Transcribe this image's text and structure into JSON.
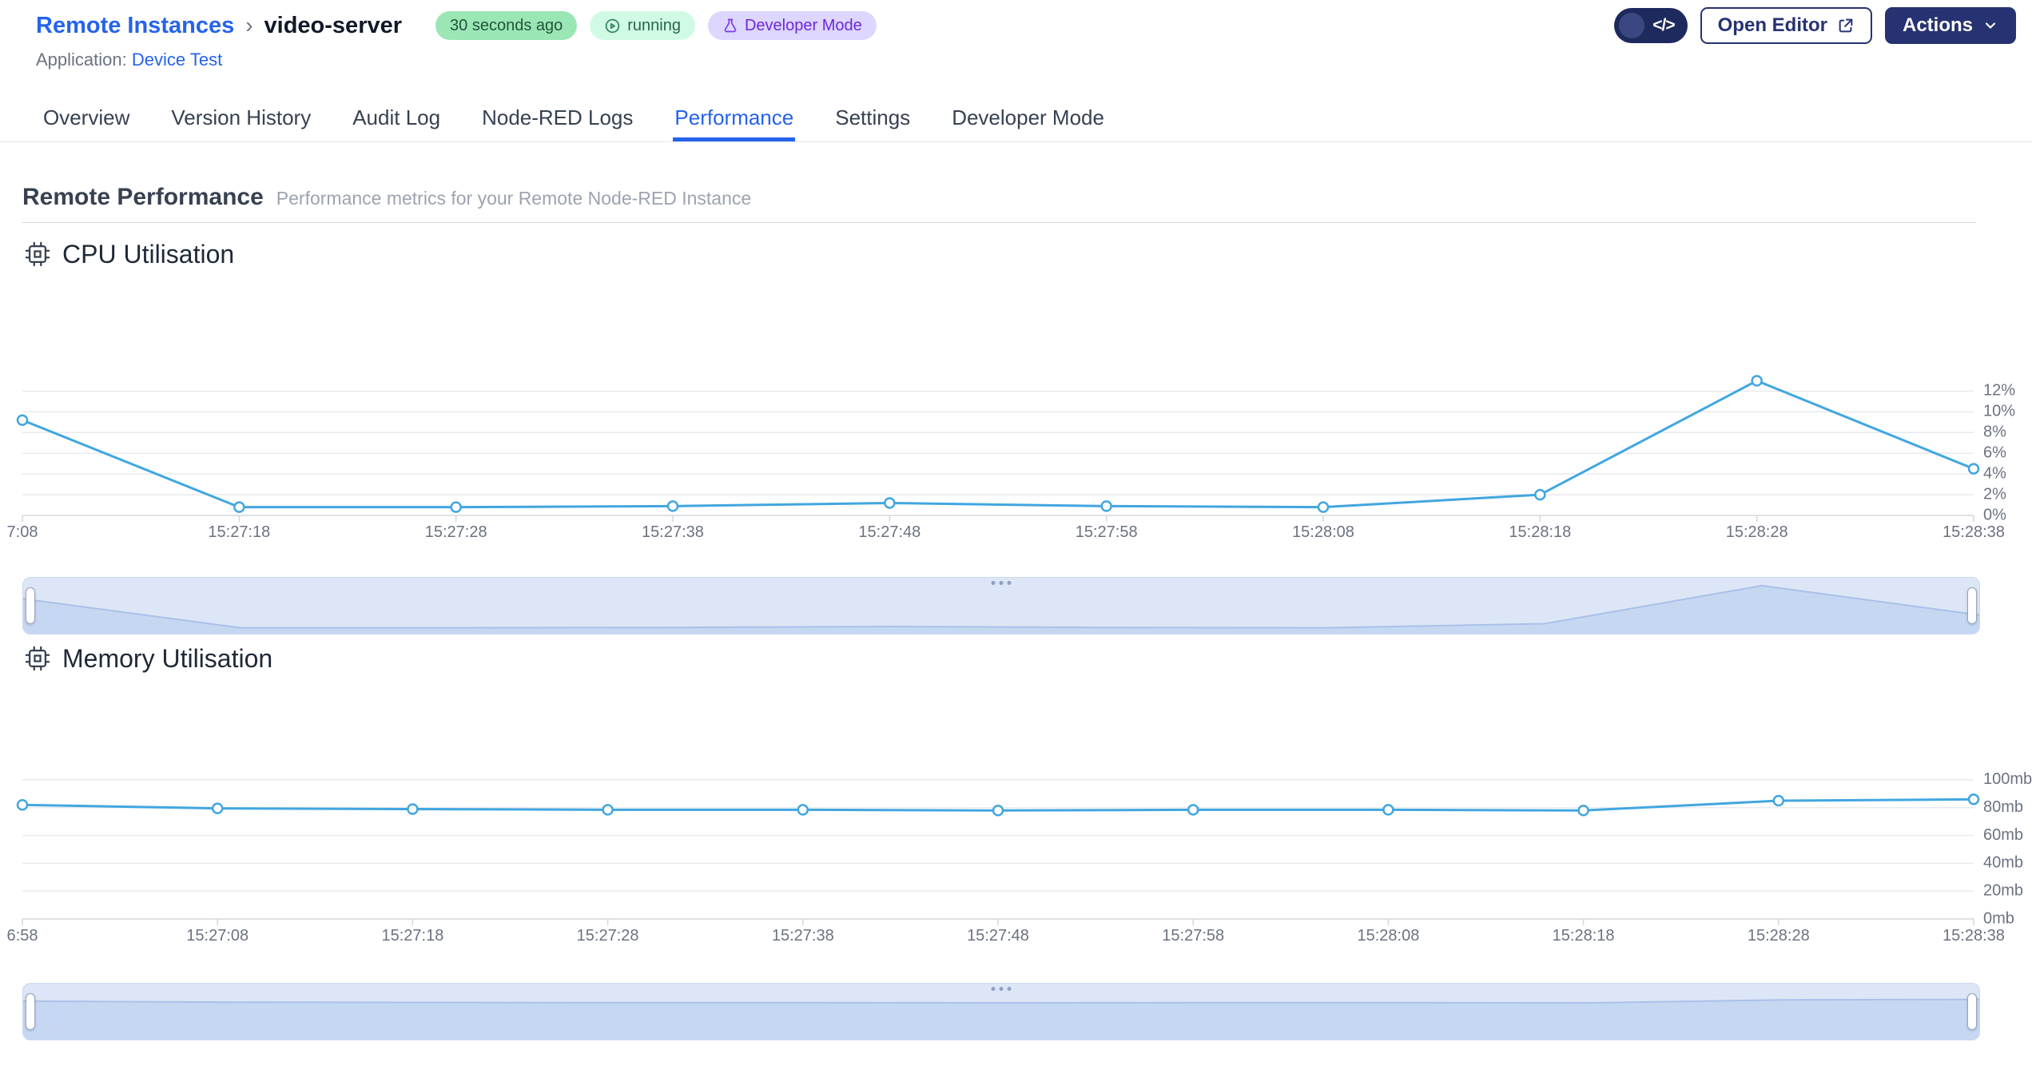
{
  "header": {
    "breadcrumb": {
      "root": "Remote Instances",
      "separator": "›",
      "current": "video-server"
    },
    "badges": {
      "last_seen": "30 seconds ago",
      "status": "running",
      "developer_mode": "Developer Mode"
    },
    "application": {
      "label": "Application:",
      "name": "Device Test"
    },
    "devmode_toggle_icon": "</>",
    "open_editor_label": "Open Editor",
    "actions_label": "Actions"
  },
  "tabs": [
    {
      "label": "Overview",
      "active": false
    },
    {
      "label": "Version History",
      "active": false
    },
    {
      "label": "Audit Log",
      "active": false
    },
    {
      "label": "Node-RED Logs",
      "active": false
    },
    {
      "label": "Performance",
      "active": true
    },
    {
      "label": "Settings",
      "active": false
    },
    {
      "label": "Developer Mode",
      "active": false
    }
  ],
  "page": {
    "title": "Remote Performance",
    "subtitle": "Performance metrics for your Remote Node-RED Instance"
  },
  "sections": [
    {
      "title": "CPU Utilisation",
      "icon": "cpu-chip-icon"
    },
    {
      "title": "Memory Utilisation",
      "icon": "cpu-chip-icon"
    }
  ],
  "colors": {
    "link_blue": "#2563eb",
    "navy": "#273272",
    "line_blue": "#41a6e0",
    "grid": "#e9eaee",
    "axis_line": "#d4d7dc",
    "axis_text": "#6b7280",
    "badge_green_bg": "#9ae6b4",
    "badge_green_light_bg": "#d1fae5",
    "badge_purple_bg": "#ddd6fe",
    "brush_bg": "#dde6f6",
    "brush_fill": "#c6d7f2",
    "brush_edge": "#a9c0e8"
  },
  "chart_data": [
    {
      "type": "line",
      "title": "CPU Utilisation",
      "x": [
        "7:08",
        "15:27:18",
        "15:27:28",
        "15:27:38",
        "15:27:48",
        "15:27:58",
        "15:28:08",
        "15:28:18",
        "15:28:28",
        "15:28:38"
      ],
      "values": [
        9.2,
        0.8,
        0.8,
        0.9,
        1.2,
        0.9,
        0.8,
        2.0,
        13.0,
        4.5
      ],
      "ylim": [
        0,
        13.5
      ],
      "yticks": [
        0,
        2,
        4,
        6,
        8,
        10,
        12
      ],
      "ytick_labels": [
        "0%",
        "2%",
        "4%",
        "6%",
        "8%",
        "10%",
        "12%"
      ],
      "xlabel": "",
      "ylabel": "",
      "grid": true,
      "legend": "none",
      "line_color": "#41a6e0",
      "marker": "circle-open",
      "brush": true
    },
    {
      "type": "line",
      "title": "Memory Utilisation",
      "x": [
        "6:58",
        "15:27:08",
        "15:27:18",
        "15:27:28",
        "15:27:38",
        "15:27:48",
        "15:27:58",
        "15:28:08",
        "15:28:18",
        "15:28:28",
        "15:28:38"
      ],
      "values": [
        82,
        79.5,
        79,
        78.5,
        78.5,
        78,
        78.5,
        78.5,
        78,
        85,
        86
      ],
      "ylim": [
        0,
        108
      ],
      "yticks": [
        0,
        20,
        40,
        60,
        80,
        100
      ],
      "ytick_labels": [
        "0mb",
        "20mb",
        "40mb",
        "60mb",
        "80mb",
        "100mb"
      ],
      "xlabel": "",
      "ylabel": "",
      "grid": true,
      "legend": "none",
      "line_color": "#41a6e0",
      "marker": "circle-open",
      "brush": true
    }
  ]
}
